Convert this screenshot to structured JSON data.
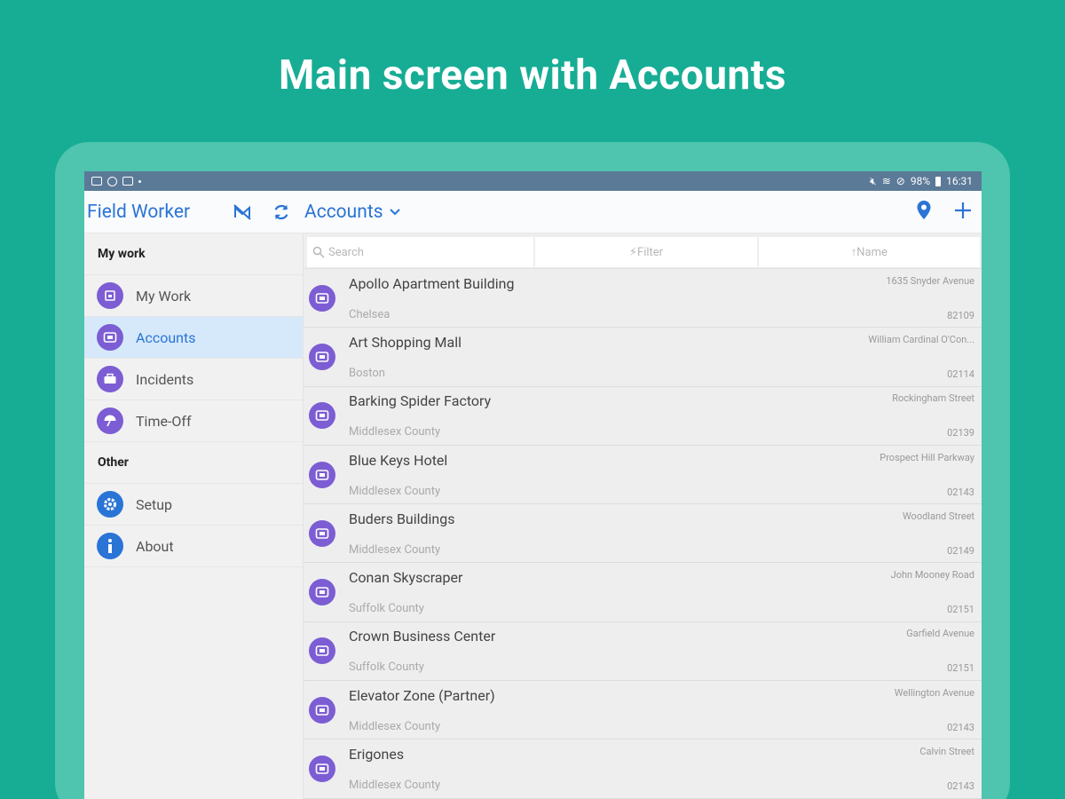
{
  "headline": "Main screen with Accounts",
  "status": {
    "battery": "98%",
    "time": "16:31"
  },
  "app": {
    "title": "Field Worker",
    "view": "Accounts"
  },
  "sidebar": {
    "section1": "My work",
    "items1": [
      {
        "label": "My Work",
        "icon": "calendar-icon"
      },
      {
        "label": "Accounts",
        "icon": "building-icon"
      },
      {
        "label": "Incidents",
        "icon": "toolbox-icon"
      },
      {
        "label": "Time-Off",
        "icon": "umbrella-icon"
      }
    ],
    "section2": "Other",
    "items2": [
      {
        "label": "Setup",
        "icon": "gear-icon"
      },
      {
        "label": "About",
        "icon": "info-icon"
      }
    ]
  },
  "filters": {
    "search": "Search",
    "filter": "Filter",
    "sort": "Name"
  },
  "accounts": [
    {
      "name": "Apollo Apartment Building",
      "area": "Chelsea",
      "street": "1635 Snyder Avenue",
      "zip": "82109"
    },
    {
      "name": "Art Shopping Mall",
      "area": "Boston",
      "street": "William Cardinal O'Con...",
      "zip": "02114"
    },
    {
      "name": "Barking Spider Factory",
      "area": "Middlesex County",
      "street": "Rockingham Street",
      "zip": "02139"
    },
    {
      "name": "Blue Keys Hotel",
      "area": "Middlesex County",
      "street": "Prospect Hill Parkway",
      "zip": "02143"
    },
    {
      "name": "Buders Buildings",
      "area": "Middlesex County",
      "street": "Woodland Street",
      "zip": "02149"
    },
    {
      "name": "Conan Skyscraper",
      "area": "Suffolk County",
      "street": "John Mooney Road",
      "zip": "02151"
    },
    {
      "name": "Crown Business Center",
      "area": "Suffolk County",
      "street": "Garfield Avenue",
      "zip": "02151"
    },
    {
      "name": "Elevator Zone (Partner)",
      "area": "Middlesex County",
      "street": "Wellington Avenue",
      "zip": "02143"
    },
    {
      "name": "Erigones",
      "area": "Middlesex County",
      "street": "Calvin Street",
      "zip": "02143"
    }
  ]
}
